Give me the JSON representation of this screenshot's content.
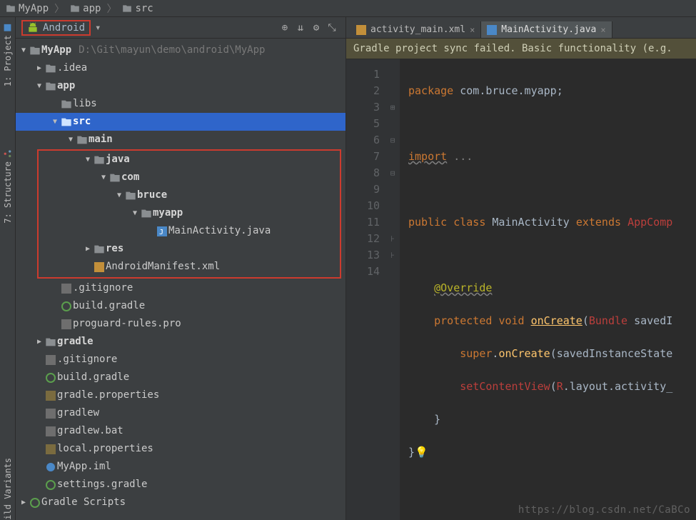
{
  "breadcrumb": [
    "MyApp",
    "app",
    "src"
  ],
  "viewer_label": "Android",
  "sidebar_tabs": {
    "project": "1: Project",
    "structure": "7: Structure",
    "build_variants": "ild Variants"
  },
  "tree": {
    "root": {
      "label": "MyApp",
      "path": "D:\\Git\\mayun\\demo\\android\\MyApp"
    },
    "items": {
      "idea": ".idea",
      "app": "app",
      "libs": "libs",
      "src": "src",
      "main": "main",
      "java": "java",
      "com": "com",
      "bruce": "bruce",
      "myapp": "myapp",
      "main_activity": "MainActivity.java",
      "res": "res",
      "manifest": "AndroidManifest.xml",
      "gitignore1": ".gitignore",
      "build_gradle1": "build.gradle",
      "proguard": "proguard-rules.pro",
      "gradle_dir": "gradle",
      "gitignore2": ".gitignore",
      "build_gradle2": "build.gradle",
      "gradle_props": "gradle.properties",
      "gradlew": "gradlew",
      "gradlew_bat": "gradlew.bat",
      "local_props": "local.properties",
      "iml": "MyApp.iml",
      "settings_gradle": "settings.gradle",
      "gradle_scripts": "Gradle Scripts"
    }
  },
  "editor": {
    "tabs": [
      {
        "label": "activity_main.xml",
        "active": false
      },
      {
        "label": "MainActivity.java",
        "active": true
      }
    ],
    "banner": "Gradle project sync failed. Basic functionality (e.g.",
    "line_numbers": [
      "1",
      "2",
      "3",
      "5",
      "6",
      "7",
      "8",
      "9",
      "10",
      "11",
      "12",
      "13",
      "14"
    ],
    "code": {
      "l1_kw": "package",
      "l1_pkg": " com.bruce.myapp;",
      "l3_kw": "import",
      "l3_rest": " ...",
      "l6_public": "public ",
      "l6_class": "class ",
      "l6_name": "MainActivity ",
      "l6_ext": "extends ",
      "l6_super": "AppComp",
      "l8_ann": "@Override",
      "l9_prot": "protected ",
      "l9_void": "void ",
      "l9_fn": "onCreate",
      "l9_paren": "(",
      "l9_bundle": "Bundle",
      "l9_rest": " savedI",
      "l10_super": "super",
      "l10_dot": ".",
      "l10_call": "onCreate",
      "l10_rest": "(savedInstanceState",
      "l11_fn": "setContentView",
      "l11_p1": "(",
      "l11_R": "R",
      "l11_rest": ".layout.activity_",
      "l12": "}",
      "l13": "}"
    }
  },
  "watermark": "https://blog.csdn.net/CaBCo"
}
